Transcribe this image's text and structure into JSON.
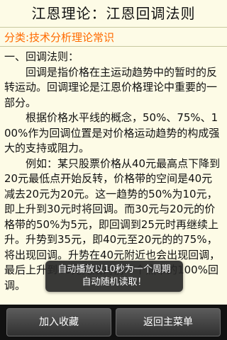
{
  "header": {
    "title": "江恩理论：江恩回调法则"
  },
  "category": {
    "text": "分类:技术分析理论常识"
  },
  "article": {
    "section_heading": "一、回调法则：",
    "paragraphs": [
      "回调是指价格在主运动趋势中的暂时的反转运动。回调理论是江恩价格理论中重要的一部分。",
      "根据价格水平线的概念，50%、75%、100%作为回调位置是对价格运动趋势的构成强大的支持或阻力。",
      "例如：某只股票价格从40元最高点下降到20元最低点开始反转，价格带的空间是40元减去20元为20元。这一趋势的50%为10元，即上升到30元时将回调。而30元与20元的价格带的50%为5元，即回调到25元时再继续上升。升势到35元，即40元至20元的的75%，将出现回调。升势在40元附近也会出现回调，最后上升到40元完成对前一个熊市的100%回调。"
    ]
  },
  "toast": {
    "line1": "自动播放以10秒为一个周期",
    "line2": "自动随机读取！"
  },
  "bottom_bar": {
    "favorite_label": "加入收藏",
    "home_label": "返回主菜单"
  }
}
